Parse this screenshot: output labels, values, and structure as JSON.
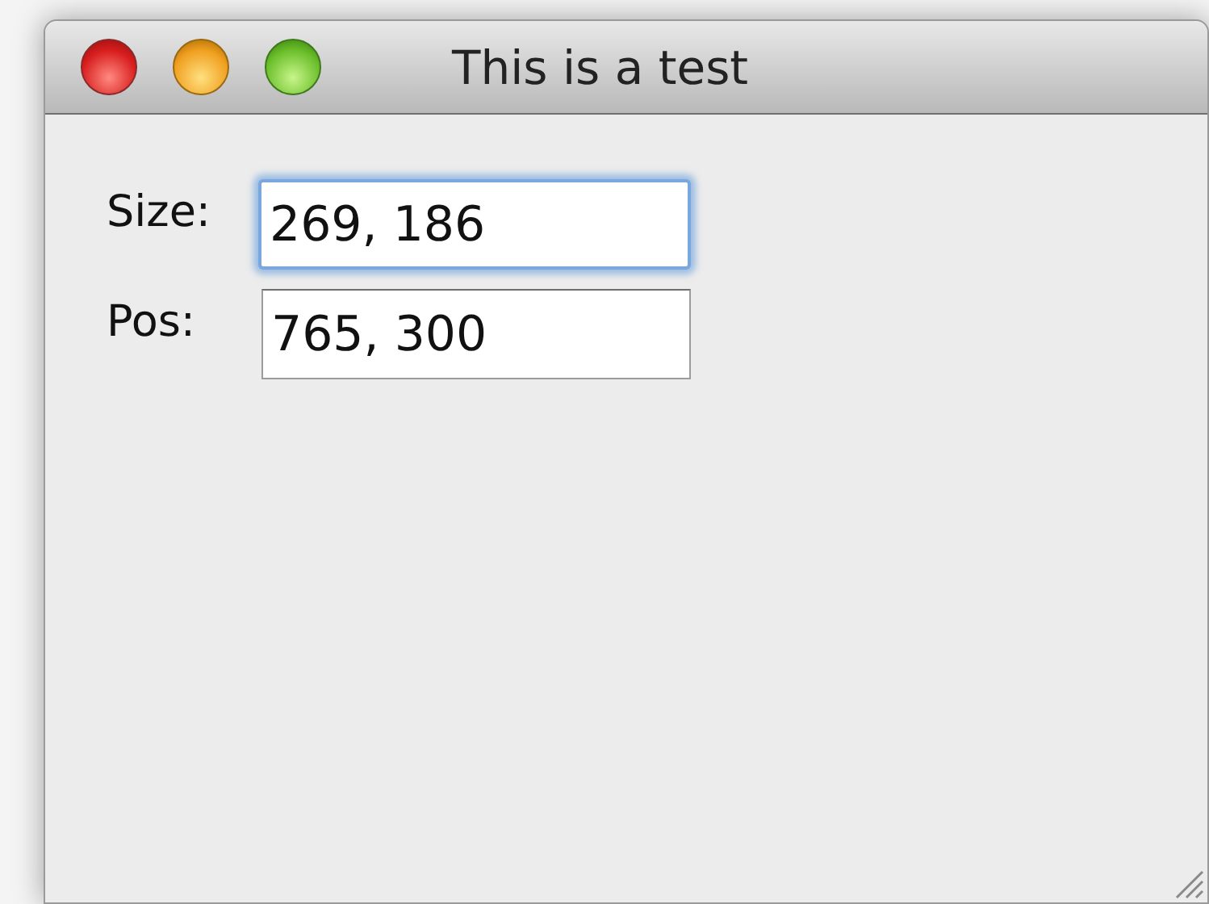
{
  "window": {
    "title": "This is a test"
  },
  "fields": [
    {
      "label": "Size:",
      "value": "269, 186",
      "focused": true
    },
    {
      "label": "Pos:",
      "value": "765, 300",
      "focused": false
    }
  ]
}
